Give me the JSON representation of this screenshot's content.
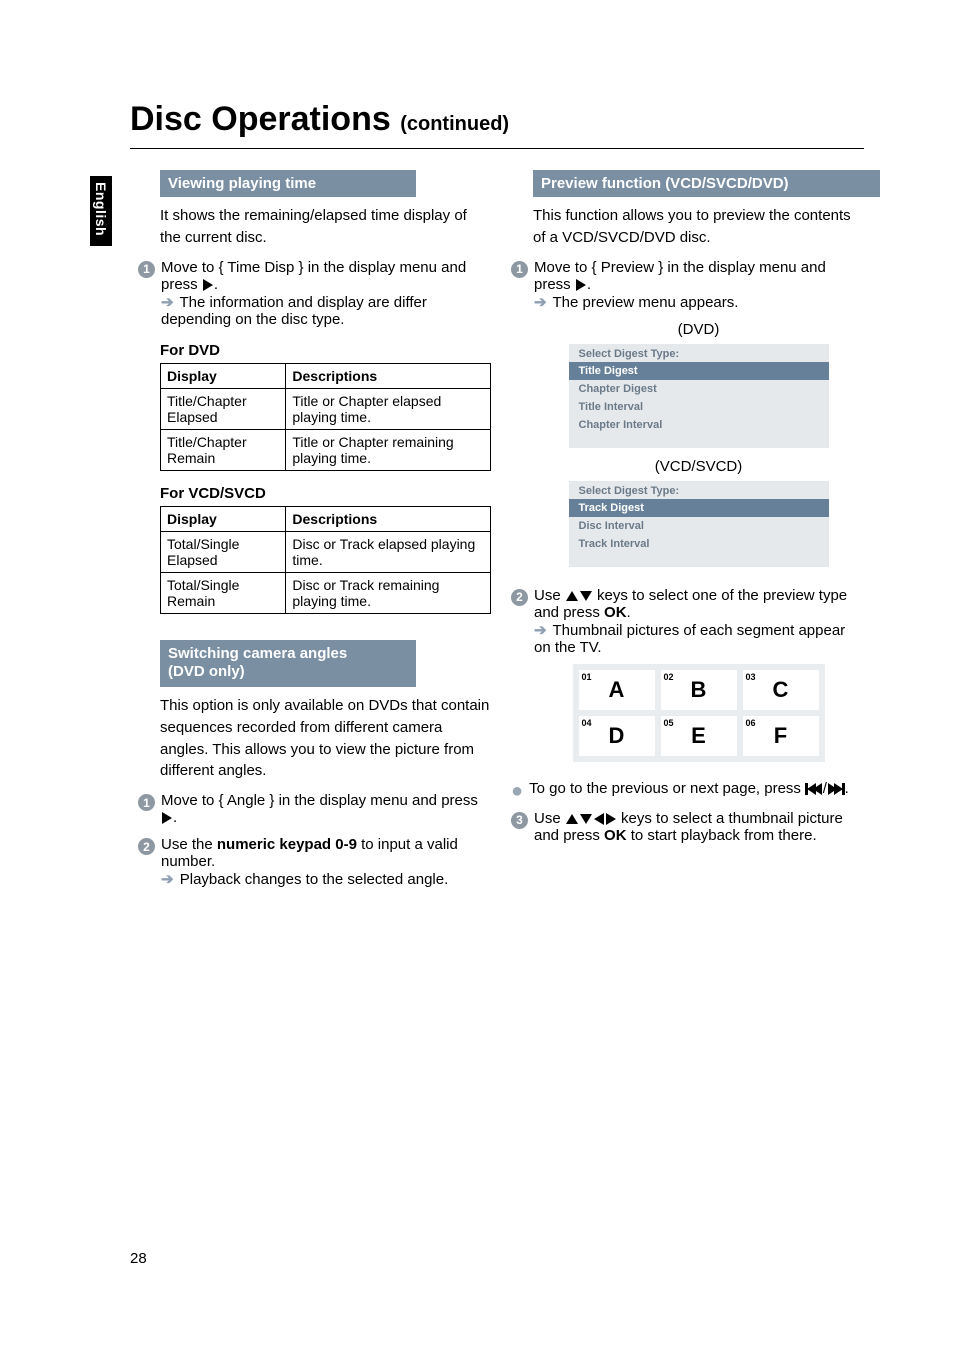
{
  "page_number": "28",
  "side_label": "English",
  "title_main": "Disc Operations",
  "title_sub": "(continued)",
  "left": {
    "section1": {
      "header": "Viewing playing time",
      "intro": "It shows the remaining/elapsed time display of the current disc.",
      "step1_a": "Move to { Time Disp } in the display menu and press ",
      "step1_b": ".",
      "result1": "The information and display are differ depending on the disc type.",
      "dvd_caption": "For DVD",
      "dvd_table": {
        "h1": "Display",
        "h2": "Descriptions",
        "r1c1": "Title/Chapter Elapsed",
        "r1c2": "Title or Chapter elapsed playing time.",
        "r2c1": "Title/Chapter Remain",
        "r2c2": "Title or Chapter remaining playing time."
      },
      "vcd_caption": "For VCD/SVCD",
      "vcd_table": {
        "h1": "Display",
        "h2": "Descriptions",
        "r1c1": "Total/Single Elapsed",
        "r1c2": "Disc or Track elapsed playing time.",
        "r2c1": "Total/Single Remain",
        "r2c2": "Disc or Track remaining playing time."
      }
    },
    "section2": {
      "header_l1": "Switching camera angles",
      "header_l2": "(DVD only)",
      "intro": "This option is only available on DVDs that contain sequences recorded from different camera angles. This allows you to view the picture from different angles.",
      "step1_a": "Move to { Angle } in the display menu and press ",
      "step1_b": ".",
      "step2_a": "Use the ",
      "step2_kb": "numeric keypad 0-9",
      "step2_b": " to input a valid number.",
      "result2": "Playback changes to the selected angle."
    }
  },
  "right": {
    "section1": {
      "header": "Preview function (VCD/SVCD/DVD)",
      "intro": "This function allows you to preview the contents of a VCD/SVCD/DVD disc.",
      "step1_a": "Move to { Preview } in the display menu and press ",
      "step1_b": ".",
      "result1": "The preview menu appears.",
      "cap_dvd": "(DVD)",
      "menu_dvd": {
        "title": "Select Digest Type:",
        "items": [
          "Title  Digest",
          "Chapter  Digest",
          "Title Interval",
          "Chapter Interval"
        ]
      },
      "cap_vcd": "(VCD/SVCD)",
      "menu_vcd": {
        "title": "Select Digest Type:",
        "items": [
          "Track  Digest",
          "Disc Interval",
          "Track Interval"
        ]
      },
      "step2_a": "Use ",
      "step2_b": " keys to select one of the preview type and press ",
      "step2_ok": "OK",
      "step2_c": ".",
      "result2": "Thumbnail pictures of each segment appear on the TV.",
      "thumbs": [
        {
          "n": "01",
          "l": "A"
        },
        {
          "n": "02",
          "l": "B"
        },
        {
          "n": "03",
          "l": "C"
        },
        {
          "n": "04",
          "l": "D"
        },
        {
          "n": "05",
          "l": "E"
        },
        {
          "n": "06",
          "l": "F"
        }
      ],
      "bullet_a": "To go to the previous or next page, press ",
      "bullet_sep": " / ",
      "bullet_b": ".",
      "step3_a": "Use ",
      "step3_b": " keys to select a thumbnail picture and press ",
      "step3_ok": "OK",
      "step3_c": " to start playback from there."
    }
  }
}
